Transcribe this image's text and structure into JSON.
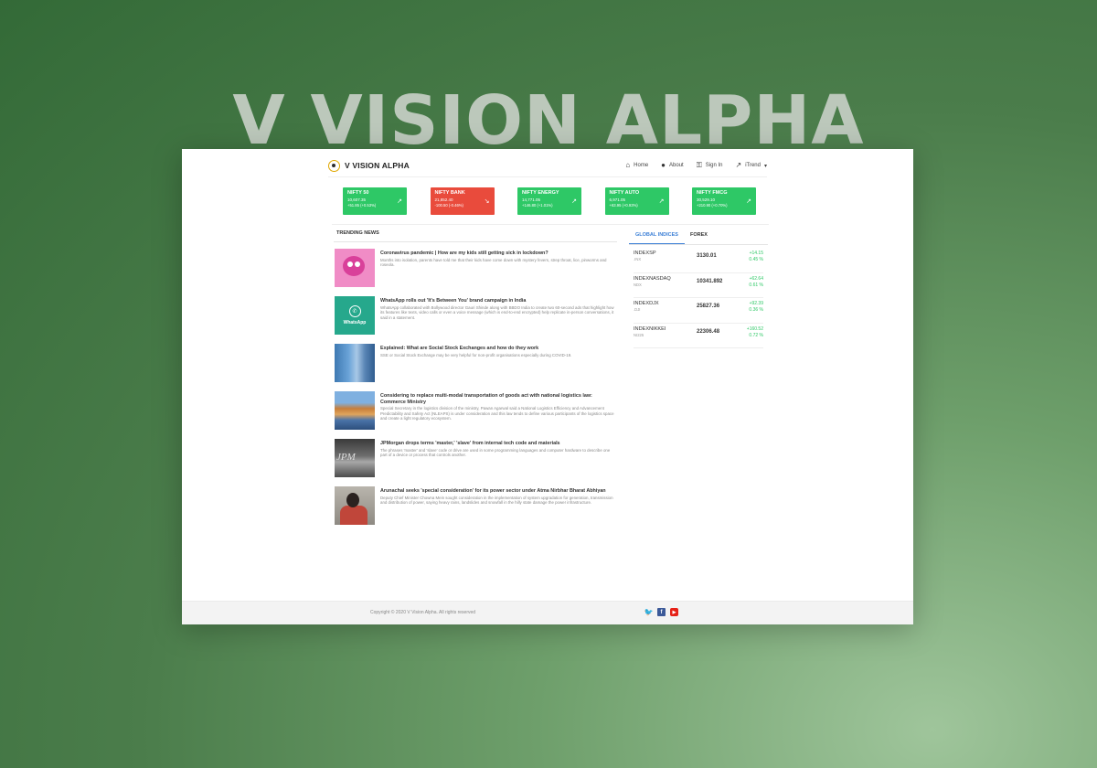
{
  "hero": {
    "title": "V VISION ALPHA"
  },
  "brand": {
    "name": "V VISION ALPHA"
  },
  "nav": [
    {
      "label": "Home",
      "icon": "home-icon",
      "glyph": "⌂"
    },
    {
      "label": "About",
      "icon": "user-icon",
      "glyph": "●"
    },
    {
      "label": "Sign In",
      "icon": "key-icon",
      "glyph": "⚿"
    },
    {
      "label": "iTrend",
      "icon": "trend-icon",
      "glyph": "↗",
      "caret": "▾"
    }
  ],
  "cards": [
    {
      "name": "NIFTY 50",
      "value": "10,607.35",
      "change": "+51.85 (+0.53%)",
      "trend": "up",
      "arrow": "↗"
    },
    {
      "name": "NIFTY BANK",
      "value": "21,852.40",
      "change": "-100.50 (-0.46%)",
      "trend": "down",
      "arrow": "↘"
    },
    {
      "name": "NIFTY ENERGY",
      "value": "14,771.05",
      "change": "+146.80 (+1.01%)",
      "trend": "up",
      "arrow": "↗"
    },
    {
      "name": "NIFTY AUTO",
      "value": "6,971.05",
      "change": "+63.95 (+0.93%)",
      "trend": "up",
      "arrow": "↗"
    },
    {
      "name": "NIFTY FMCG",
      "value": "30,529.10",
      "change": "+210.90 (+0.70%)",
      "trend": "up",
      "arrow": "↗"
    }
  ],
  "news": {
    "heading": "TRENDING NEWS",
    "items": [
      {
        "title": "Coronavirus pandemic | How are my kids still getting sick in lockdown?",
        "summary": "Months into isolation, parents have told me that their kids have come down with mystery fevers, strep throat, lice, pinworms and roseola.",
        "thumb": "germ-image"
      },
      {
        "title": "WhatsApp rolls out 'It's Between You' brand campaign in India",
        "summary": "WhatsApp collaborated with Bollywood director Gauri Shinde along with BBDO India to create two 60-second ads that highlight how its features like texts, video calls or even a voice message (which is end-to-end encrypted) help replicate in-person conversations, it said in a statement.",
        "thumb": "whatsapp-image",
        "thumb_label": "WhatsApp"
      },
      {
        "title": "Explained: What are Social Stock Exchanges and how do they work",
        "summary": "SSE or Social Stock Exchange may be very helpful for non-profit organisations especially during COVID-19.",
        "thumb": "building-image"
      },
      {
        "title": "Considering to replace multi-modal transportation of goods act with national logistics law: Commerce Ministry",
        "summary": "Special Secretary in the logistics division of the ministry, Pawan Agarwal said a National Logistics Efficiency and Advancement Predictability and Safety Act (NLEAPS) is under consideration and this law tends to define various participants of the logistics space and create a light regulatory ecosystem.",
        "thumb": "port-image"
      },
      {
        "title": "JPMorgan drops terms 'master,' 'slave' from internal tech code and materials",
        "summary": "The phrases 'master' and 'slave' code or drive are used in some programming languages and computer hardware to describe one part of a device or process that controls another.",
        "thumb": "jpmorgan-image",
        "thumb_label": "JPM"
      },
      {
        "title": "Arunachal seeks 'special consideration' for its power sector under Atma Nirbhar Bharat Abhiyan",
        "summary": "Deputy Chief Minister Chowna Mein sought consideration in the implementation of system upgradation for generation, transmission and distribution of power, saying heavy rains, landslides and snowfall in the hilly state damage the power infrastructure.",
        "thumb": "person-image"
      }
    ]
  },
  "indices": {
    "tabs": [
      {
        "label": "GLOBAL INDICES",
        "active": true
      },
      {
        "label": "FOREX",
        "active": false
      }
    ],
    "rows": [
      {
        "name": "INDEXSP",
        "ticker": ".INX",
        "price": "3130.01",
        "change": "+14.15",
        "pct": "0.45 %"
      },
      {
        "name": "INDEXNASDAQ",
        "ticker": "NDX",
        "price": "10341.892",
        "change": "+62.64",
        "pct": "0.61 %"
      },
      {
        "name": "INDEXDJX",
        "ticker": ".DJI",
        "price": "25827.36",
        "change": "+92.39",
        "pct": "0.36 %"
      },
      {
        "name": "INDEXNIKKEI",
        "ticker": "NI225",
        "price": "22306.48",
        "change": "+160.52",
        "pct": "0.72 %"
      }
    ]
  },
  "footer": {
    "copyright": "Copyright © 2020 V Vision Alpha. All rights reserved",
    "social": [
      {
        "name": "twitter-icon",
        "glyph": "🐦"
      },
      {
        "name": "facebook-icon",
        "glyph": "f"
      },
      {
        "name": "youtube-icon",
        "glyph": "▶"
      }
    ]
  },
  "colors": {
    "up": "#2ec866",
    "down": "#e94b3c",
    "accent": "#3b7fd6",
    "bg_green": "#4b7d4b"
  }
}
